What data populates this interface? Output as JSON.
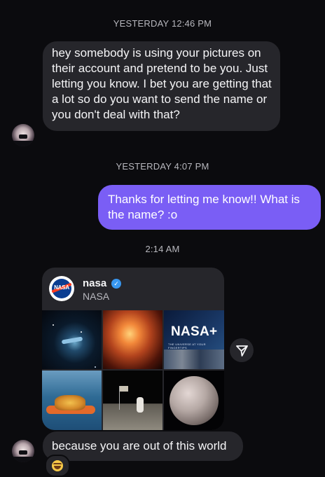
{
  "timestamps": {
    "first": "YESTERDAY 12:46 PM",
    "second": "YESTERDAY 4:07 PM",
    "third": "2:14 AM"
  },
  "messages": {
    "incoming_1": "hey somebody is using your pictures on their account and pretend to be you. Just letting you know. I bet you are getting that a lot so do you want to send the name or you don't deal with that?",
    "outgoing_1": "Thanks for letting me know!! What is the name? :o",
    "incoming_2": "because you are out of this world"
  },
  "shared_post": {
    "username": "nasa",
    "display_name": "NASA",
    "verified": true,
    "logo_text": "NASA",
    "tile_brand": "NASA+",
    "tile_tagline": "THE UNIVERSE AT YOUR FINGERTIPS"
  },
  "reaction": {
    "emoji_name": "laughing-face-emoji"
  },
  "colors": {
    "background": "#0b0b0e",
    "incoming_bubble": "#26262b",
    "outgoing_bubble": "#7a5ef5",
    "verified_badge": "#3897f0"
  },
  "icons": {
    "share": "paper-plane-icon",
    "verified": "verified-check-icon"
  }
}
